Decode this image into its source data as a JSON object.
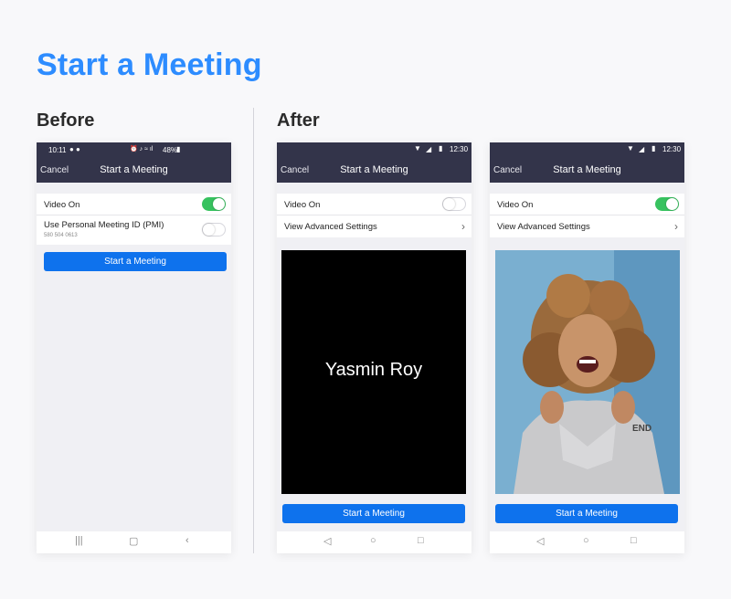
{
  "page": {
    "title": "Start a Meeting"
  },
  "sections": {
    "before": "Before",
    "after": "After"
  },
  "before": {
    "status": {
      "time": "10:11",
      "right": "48%"
    },
    "header": {
      "cancel": "Cancel",
      "title": "Start a Meeting"
    },
    "rows": {
      "video_on": {
        "label": "Video On",
        "on": true
      },
      "pmi": {
        "label": "Use Personal Meeting ID (PMI)",
        "sub": "580 504 0613",
        "on": false
      }
    },
    "button": "Start a Meeting"
  },
  "after_a": {
    "status": {
      "time": "12:30"
    },
    "header": {
      "cancel": "Cancel",
      "title": "Start a Meeting"
    },
    "rows": {
      "video_on": {
        "label": "Video On",
        "on": false
      },
      "advanced": {
        "label": "View Advanced Settings"
      }
    },
    "preview_name": "Yasmin Roy",
    "button": "Start a Meeting"
  },
  "after_b": {
    "status": {
      "time": "12:30"
    },
    "header": {
      "cancel": "Cancel",
      "title": "Start a Meeting"
    },
    "rows": {
      "video_on": {
        "label": "Video On",
        "on": true
      },
      "advanced": {
        "label": "View Advanced Settings"
      }
    },
    "button": "Start a Meeting"
  },
  "colors": {
    "accent": "#2d8cff",
    "button": "#0e72ed",
    "toggle_on": "#37c25f",
    "header": "#33344a"
  },
  "icons": [
    "wifi-icon",
    "signal-icon",
    "battery-icon",
    "chevron-right-icon",
    "nav-recents-icon",
    "nav-home-icon",
    "nav-back-icon"
  ]
}
